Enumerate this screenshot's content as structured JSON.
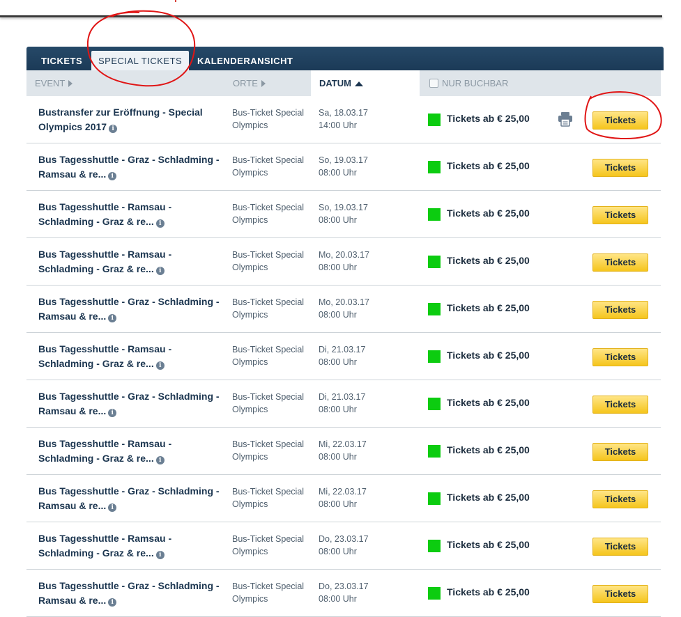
{
  "tabs": [
    {
      "label": "TICKETS"
    },
    {
      "label": "SPECIAL TICKETS",
      "active": true
    },
    {
      "label": "KALENDERANSICHT"
    }
  ],
  "columns": {
    "event": "EVENT",
    "orte": "ORTE",
    "datum": "DATUM",
    "nur_buchbar": "NUR BUCHBAR"
  },
  "colors": {
    "tabbar": "#1f3f5e",
    "available": "#0ccc10",
    "button": "#f5c51d",
    "annotation": "#e01515"
  },
  "rows": [
    {
      "event": "Bustransfer zur Eröffnung - Special Olympics 2017",
      "orte_1": "Bus-Ticket Special",
      "orte_2": "Olympics",
      "date": "Sa, 18.03.17",
      "time": "14:00 Uhr",
      "price": "Tickets ab € 25,00",
      "button": "Tickets",
      "print": true
    },
    {
      "event": "Bus Tagesshuttle - Graz - Schladming - Ramsau & re...",
      "orte_1": "Bus-Ticket Special",
      "orte_2": "Olympics",
      "date": "So, 19.03.17",
      "time": "08:00 Uhr",
      "price": "Tickets ab € 25,00",
      "button": "Tickets"
    },
    {
      "event": "Bus Tagesshuttle - Ramsau - Schladming - Graz & re...",
      "orte_1": "Bus-Ticket Special",
      "orte_2": "Olympics",
      "date": "So, 19.03.17",
      "time": "08:00 Uhr",
      "price": "Tickets ab € 25,00",
      "button": "Tickets"
    },
    {
      "event": "Bus Tagesshuttle - Ramsau - Schladming - Graz & re...",
      "orte_1": "Bus-Ticket Special",
      "orte_2": "Olympics",
      "date": "Mo, 20.03.17",
      "time": "08:00 Uhr",
      "price": "Tickets ab € 25,00",
      "button": "Tickets"
    },
    {
      "event": "Bus Tagesshuttle - Graz - Schladming - Ramsau & re...",
      "orte_1": "Bus-Ticket Special",
      "orte_2": "Olympics",
      "date": "Mo, 20.03.17",
      "time": "08:00 Uhr",
      "price": "Tickets ab € 25,00",
      "button": "Tickets"
    },
    {
      "event": "Bus Tagesshuttle - Ramsau - Schladming - Graz & re...",
      "orte_1": "Bus-Ticket Special",
      "orte_2": "Olympics",
      "date": "Di, 21.03.17",
      "time": "08:00 Uhr",
      "price": "Tickets ab € 25,00",
      "button": "Tickets"
    },
    {
      "event": "Bus Tagesshuttle - Graz - Schladming - Ramsau & re...",
      "orte_1": "Bus-Ticket Special",
      "orte_2": "Olympics",
      "date": "Di, 21.03.17",
      "time": "08:00 Uhr",
      "price": "Tickets ab € 25,00",
      "button": "Tickets"
    },
    {
      "event": "Bus Tagesshuttle - Ramsau - Schladming - Graz & re...",
      "orte_1": "Bus-Ticket Special",
      "orte_2": "Olympics",
      "date": "Mi, 22.03.17",
      "time": "08:00 Uhr",
      "price": "Tickets ab € 25,00",
      "button": "Tickets"
    },
    {
      "event": "Bus Tagesshuttle - Graz - Schladming - Ramsau & re...",
      "orte_1": "Bus-Ticket Special",
      "orte_2": "Olympics",
      "date": "Mi, 22.03.17",
      "time": "08:00 Uhr",
      "price": "Tickets ab € 25,00",
      "button": "Tickets"
    },
    {
      "event": "Bus Tagesshuttle - Ramsau - Schladming - Graz & re...",
      "orte_1": "Bus-Ticket Special",
      "orte_2": "Olympics",
      "date": "Do, 23.03.17",
      "time": "08:00 Uhr",
      "price": "Tickets ab € 25,00",
      "button": "Tickets"
    },
    {
      "event": "Bus Tagesshuttle - Graz - Schladming - Ramsau & re...",
      "orte_1": "Bus-Ticket Special",
      "orte_2": "Olympics",
      "date": "Do, 23.03.17",
      "time": "08:00 Uhr",
      "price": "Tickets ab € 25,00",
      "button": "Tickets"
    }
  ]
}
